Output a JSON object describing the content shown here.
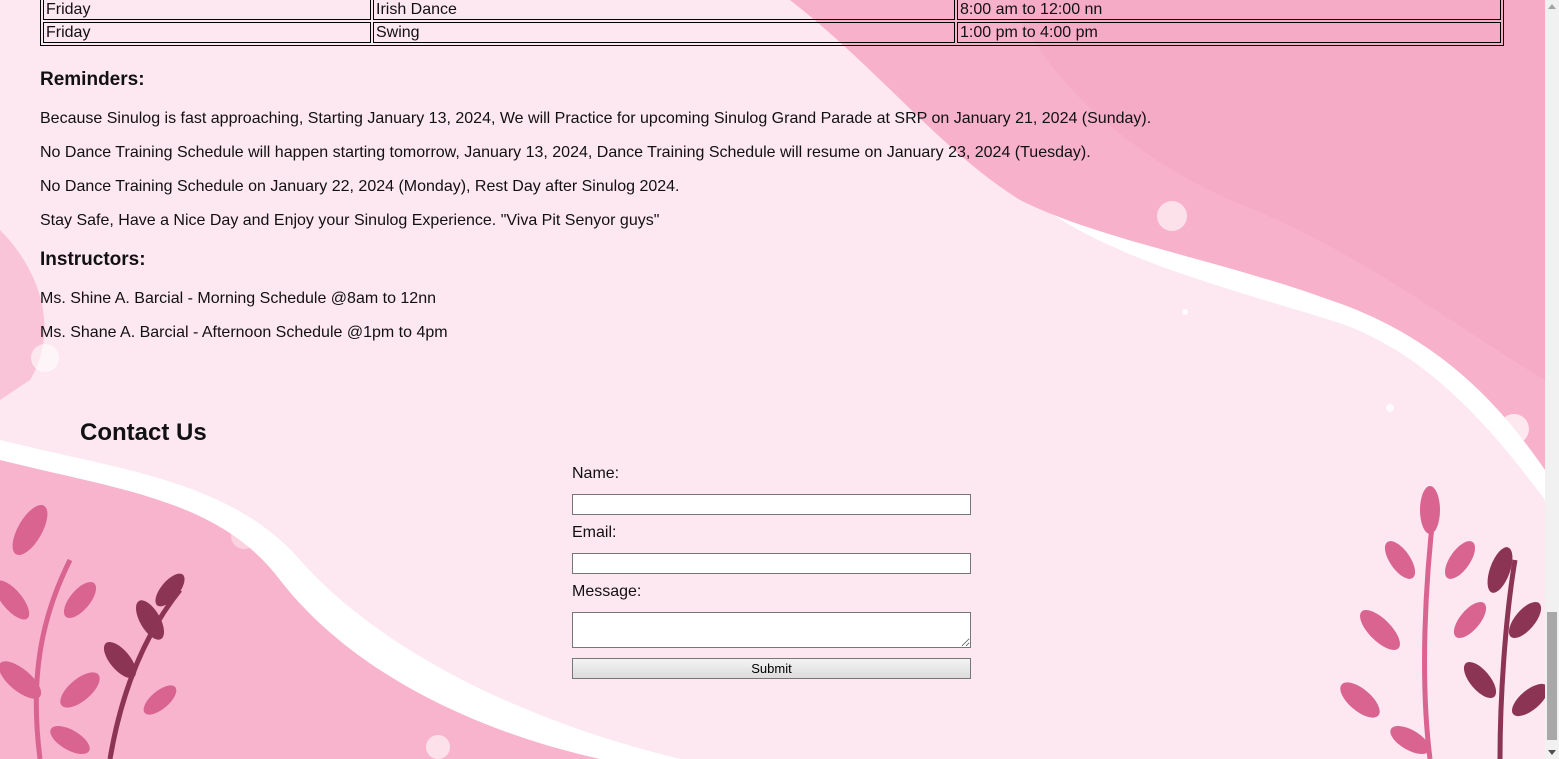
{
  "colors": {
    "page_bg": "#fde7f1",
    "pink_mid": "#f9b6cf",
    "pink_dark": "#f4a2c0",
    "white_wave": "#ffffff",
    "leaf_light": "#db6c97",
    "leaf_dark": "#8c3453"
  },
  "schedule_rows": [
    {
      "day": "Friday",
      "dance": "Irish Dance",
      "time": "8:00 am to 12:00 nn"
    },
    {
      "day": "Friday",
      "dance": "Swing",
      "time": "1:00 pm to 4:00 pm"
    }
  ],
  "reminders": {
    "heading": "Reminders:",
    "items": [
      "Because Sinulog is fast approaching, Starting January 13, 2024, We will Practice for upcoming Sinulog Grand Parade at SRP on January 21, 2024 (Sunday).",
      "No Dance Training Schedule will happen starting tomorrow, January 13, 2024, Dance Training Schedule will resume on January 23, 2024 (Tuesday).",
      "No Dance Training Schedule on January 22, 2024 (Monday), Rest Day after Sinulog 2024.",
      "Stay Safe, Have a Nice Day and Enjoy your Sinulog Experience. \"Viva Pit Senyor guys\""
    ]
  },
  "instructors": {
    "heading": "Instructors:",
    "items": [
      "Ms. Shine A. Barcial - Morning Schedule @8am to 12nn",
      "Ms. Shane A. Barcial - Afternoon Schedule @1pm to 4pm"
    ]
  },
  "contact": {
    "title": "Contact Us",
    "name_label": "Name:",
    "name_value": "",
    "email_label": "Email:",
    "email_value": "",
    "message_label": "Message:",
    "message_value": "",
    "submit_label": "Submit"
  },
  "scrollbar": {
    "scroll_position_fraction": 0.92
  }
}
